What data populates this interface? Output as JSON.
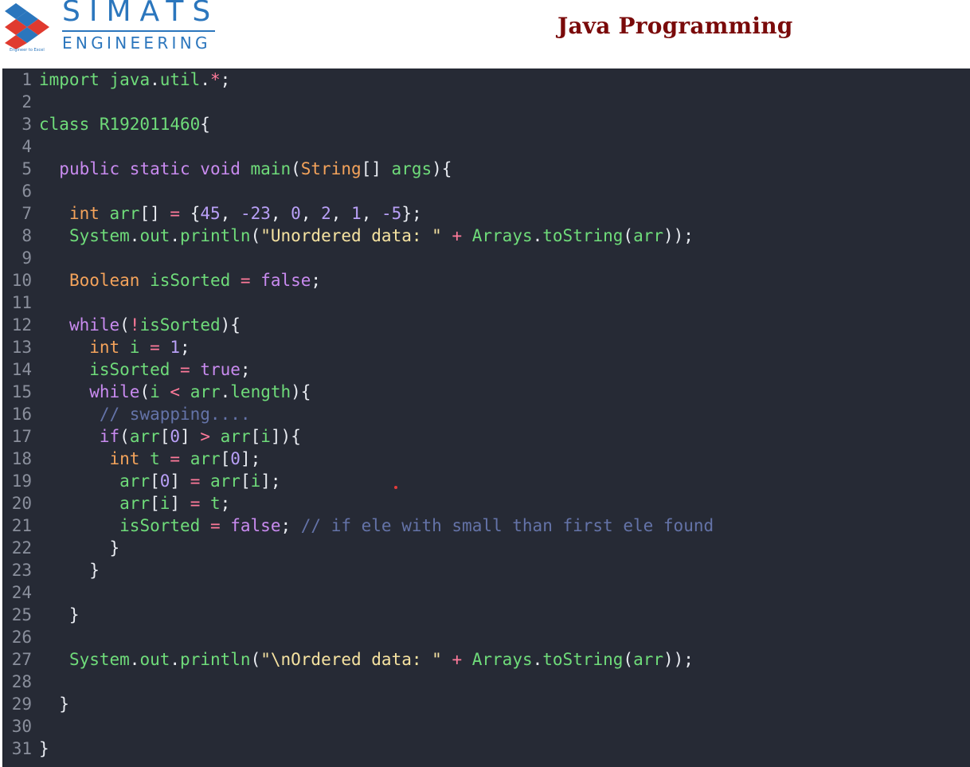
{
  "header": {
    "logo_word": "SIMATS",
    "logo_sub": "ENGINEERING",
    "logo_tagline": "Engineer to Excel",
    "title": "Java Programming"
  },
  "colors": {
    "title": "#7a0a0a",
    "logo_blue": "#2b76bd",
    "logo_red": "#e03a2f",
    "editor_bg": "#262a35",
    "keyword": "#c98bf0",
    "type": "#f4a35b",
    "identifier": "#6fdc7a",
    "string": "#f6e3a1",
    "number": "#b9a0f7",
    "operator": "#ff7a9a",
    "comment": "#6473a8"
  },
  "code": {
    "lines": [
      [
        [
          "id",
          "import "
        ],
        [
          "id",
          "java"
        ],
        [
          "pn",
          "."
        ],
        [
          "id",
          "util"
        ],
        [
          "pn",
          "."
        ],
        [
          "op",
          "*"
        ],
        [
          "pn",
          ";"
        ]
      ],
      [],
      [
        [
          "id",
          "class "
        ],
        [
          "id",
          "R192011460"
        ],
        [
          "pn",
          "{"
        ]
      ],
      [],
      [
        [
          "pn",
          "  "
        ],
        [
          "kw",
          "public static void "
        ],
        [
          "id",
          "main"
        ],
        [
          "pn",
          "("
        ],
        [
          "type",
          "String"
        ],
        [
          "pn",
          "[] "
        ],
        [
          "id",
          "args"
        ],
        [
          "pn",
          "){"
        ]
      ],
      [],
      [
        [
          "pn",
          "   "
        ],
        [
          "type",
          "int "
        ],
        [
          "id",
          "arr"
        ],
        [
          "pn",
          "[] "
        ],
        [
          "op",
          "= "
        ],
        [
          "pn",
          "{"
        ],
        [
          "num",
          "45"
        ],
        [
          "pn",
          ", "
        ],
        [
          "num",
          "-23"
        ],
        [
          "pn",
          ", "
        ],
        [
          "num",
          "0"
        ],
        [
          "pn",
          ", "
        ],
        [
          "num",
          "2"
        ],
        [
          "pn",
          ", "
        ],
        [
          "num",
          "1"
        ],
        [
          "pn",
          ", "
        ],
        [
          "num",
          "-5"
        ],
        [
          "pn",
          "};"
        ]
      ],
      [
        [
          "pn",
          "   "
        ],
        [
          "id",
          "System"
        ],
        [
          "pn",
          "."
        ],
        [
          "id",
          "out"
        ],
        [
          "pn",
          "."
        ],
        [
          "id",
          "println"
        ],
        [
          "pn",
          "("
        ],
        [
          "str",
          "\"Unordered data: \""
        ],
        [
          "pn",
          " "
        ],
        [
          "op",
          "+ "
        ],
        [
          "id",
          "Arrays"
        ],
        [
          "pn",
          "."
        ],
        [
          "id",
          "toString"
        ],
        [
          "pn",
          "("
        ],
        [
          "id",
          "arr"
        ],
        [
          "pn",
          "));"
        ]
      ],
      [],
      [
        [
          "pn",
          "   "
        ],
        [
          "type",
          "Boolean "
        ],
        [
          "id",
          "isSorted "
        ],
        [
          "op",
          "= "
        ],
        [
          "kw",
          "false"
        ],
        [
          "pn",
          ";"
        ]
      ],
      [],
      [
        [
          "pn",
          "   "
        ],
        [
          "kw",
          "while"
        ],
        [
          "pn",
          "("
        ],
        [
          "op",
          "!"
        ],
        [
          "id",
          "isSorted"
        ],
        [
          "pn",
          "){"
        ]
      ],
      [
        [
          "pn",
          "     "
        ],
        [
          "type",
          "int "
        ],
        [
          "id",
          "i "
        ],
        [
          "op",
          "= "
        ],
        [
          "num",
          "1"
        ],
        [
          "pn",
          ";"
        ]
      ],
      [
        [
          "pn",
          "     "
        ],
        [
          "id",
          "isSorted "
        ],
        [
          "op",
          "= "
        ],
        [
          "kw",
          "true"
        ],
        [
          "pn",
          ";"
        ]
      ],
      [
        [
          "pn",
          "     "
        ],
        [
          "kw",
          "while"
        ],
        [
          "pn",
          "("
        ],
        [
          "id",
          "i "
        ],
        [
          "op",
          "< "
        ],
        [
          "id",
          "arr"
        ],
        [
          "pn",
          "."
        ],
        [
          "id",
          "length"
        ],
        [
          "pn",
          "){"
        ]
      ],
      [
        [
          "pn",
          "      "
        ],
        [
          "cm",
          "// swapping...."
        ]
      ],
      [
        [
          "pn",
          "      "
        ],
        [
          "kw",
          "if"
        ],
        [
          "pn",
          "("
        ],
        [
          "id",
          "arr"
        ],
        [
          "pn",
          "["
        ],
        [
          "num",
          "0"
        ],
        [
          "pn",
          "] "
        ],
        [
          "op",
          "> "
        ],
        [
          "id",
          "arr"
        ],
        [
          "pn",
          "["
        ],
        [
          "id",
          "i"
        ],
        [
          "pn",
          "]){"
        ]
      ],
      [
        [
          "pn",
          "       "
        ],
        [
          "type",
          "int "
        ],
        [
          "id",
          "t "
        ],
        [
          "op",
          "= "
        ],
        [
          "id",
          "arr"
        ],
        [
          "pn",
          "["
        ],
        [
          "num",
          "0"
        ],
        [
          "pn",
          "];"
        ]
      ],
      [
        [
          "pn",
          "        "
        ],
        [
          "id",
          "arr"
        ],
        [
          "pn",
          "["
        ],
        [
          "num",
          "0"
        ],
        [
          "pn",
          "] "
        ],
        [
          "op",
          "= "
        ],
        [
          "id",
          "arr"
        ],
        [
          "pn",
          "["
        ],
        [
          "id",
          "i"
        ],
        [
          "pn",
          "];"
        ]
      ],
      [
        [
          "pn",
          "        "
        ],
        [
          "id",
          "arr"
        ],
        [
          "pn",
          "["
        ],
        [
          "id",
          "i"
        ],
        [
          "pn",
          "] "
        ],
        [
          "op",
          "= "
        ],
        [
          "id",
          "t"
        ],
        [
          "pn",
          ";"
        ]
      ],
      [
        [
          "pn",
          "        "
        ],
        [
          "id",
          "isSorted "
        ],
        [
          "op",
          "= "
        ],
        [
          "kw",
          "false"
        ],
        [
          "pn",
          "; "
        ],
        [
          "cm",
          "// if ele with small than first ele found"
        ]
      ],
      [
        [
          "pn",
          "       }"
        ]
      ],
      [
        [
          "pn",
          "     }"
        ]
      ],
      [],
      [
        [
          "pn",
          "   }"
        ]
      ],
      [],
      [
        [
          "pn",
          "   "
        ],
        [
          "id",
          "System"
        ],
        [
          "pn",
          "."
        ],
        [
          "id",
          "out"
        ],
        [
          "pn",
          "."
        ],
        [
          "id",
          "println"
        ],
        [
          "pn",
          "("
        ],
        [
          "str",
          "\"\\nOrdered data: \""
        ],
        [
          "pn",
          " "
        ],
        [
          "op",
          "+ "
        ],
        [
          "id",
          "Arrays"
        ],
        [
          "pn",
          "."
        ],
        [
          "id",
          "toString"
        ],
        [
          "pn",
          "("
        ],
        [
          "id",
          "arr"
        ],
        [
          "pn",
          "));"
        ]
      ],
      [],
      [
        [
          "pn",
          "  }"
        ]
      ],
      [],
      [
        [
          "pn",
          "}"
        ]
      ]
    ]
  }
}
